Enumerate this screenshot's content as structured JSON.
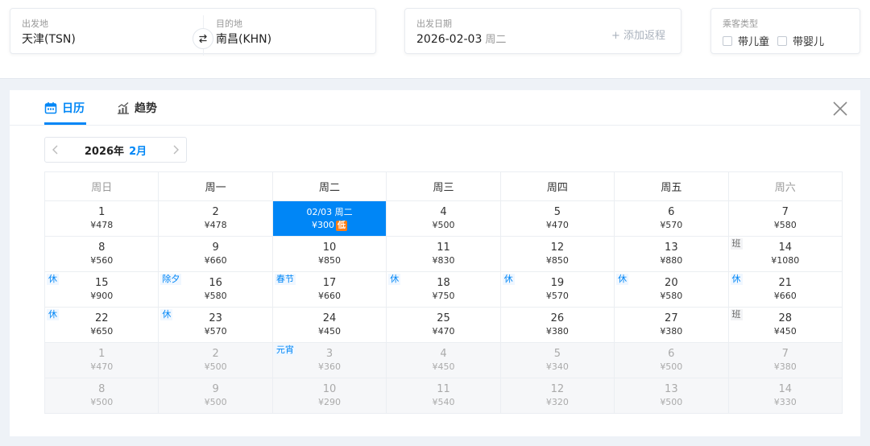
{
  "search": {
    "from_label": "出发地",
    "from_value": "天津(TSN)",
    "to_label": "目的地",
    "to_value": "南昌(KHN)",
    "date_label": "出发日期",
    "date_value": "2026-02-03",
    "date_weekday": "周二",
    "add_return": "+ 添加返程",
    "passenger_label": "乘客类型",
    "child_label": "带儿童",
    "infant_label": "带婴儿"
  },
  "tabs": {
    "calendar": "日历",
    "trend": "趋势"
  },
  "month_nav": {
    "year": "2026年",
    "month": "2月"
  },
  "weekdays": [
    "周日",
    "周一",
    "周二",
    "周三",
    "周四",
    "周五",
    "周六"
  ],
  "weeks": [
    [
      {
        "day": "1",
        "price": "¥478"
      },
      {
        "day": "2",
        "price": "¥478"
      },
      {
        "day": "02/03 周二",
        "price": "¥300",
        "selected": true,
        "badge": "低"
      },
      {
        "day": "4",
        "price": "¥500"
      },
      {
        "day": "5",
        "price": "¥470"
      },
      {
        "day": "6",
        "price": "¥570"
      },
      {
        "day": "7",
        "price": "¥580"
      }
    ],
    [
      {
        "day": "8",
        "price": "¥560"
      },
      {
        "day": "9",
        "price": "¥660"
      },
      {
        "day": "10",
        "price": "¥850"
      },
      {
        "day": "11",
        "price": "¥830"
      },
      {
        "day": "12",
        "price": "¥850"
      },
      {
        "day": "13",
        "price": "¥880"
      },
      {
        "day": "14",
        "price": "¥1080",
        "tag": "班"
      }
    ],
    [
      {
        "day": "15",
        "price": "¥900",
        "tag": "休"
      },
      {
        "day": "16",
        "price": "¥580",
        "tag": "除夕"
      },
      {
        "day": "17",
        "price": "¥660",
        "tag": "春节"
      },
      {
        "day": "18",
        "price": "¥750",
        "tag": "休"
      },
      {
        "day": "19",
        "price": "¥570",
        "tag": "休"
      },
      {
        "day": "20",
        "price": "¥580",
        "tag": "休"
      },
      {
        "day": "21",
        "price": "¥660",
        "tag": "休"
      }
    ],
    [
      {
        "day": "22",
        "price": "¥650",
        "tag": "休"
      },
      {
        "day": "23",
        "price": "¥570",
        "tag": "休"
      },
      {
        "day": "24",
        "price": "¥450"
      },
      {
        "day": "25",
        "price": "¥470"
      },
      {
        "day": "26",
        "price": "¥380"
      },
      {
        "day": "27",
        "price": "¥380"
      },
      {
        "day": "28",
        "price": "¥450",
        "tag": "班"
      }
    ],
    [
      {
        "day": "1",
        "price": "¥470",
        "next": true
      },
      {
        "day": "2",
        "price": "¥500",
        "next": true
      },
      {
        "day": "3",
        "price": "¥360",
        "next": true,
        "tag": "元宵"
      },
      {
        "day": "4",
        "price": "¥450",
        "next": true
      },
      {
        "day": "5",
        "price": "¥340",
        "next": true
      },
      {
        "day": "6",
        "price": "¥500",
        "next": true
      },
      {
        "day": "7",
        "price": "¥380",
        "next": true
      }
    ],
    [
      {
        "day": "8",
        "price": "¥500",
        "next": true
      },
      {
        "day": "9",
        "price": "¥500",
        "next": true
      },
      {
        "day": "10",
        "price": "¥290",
        "next": true
      },
      {
        "day": "11",
        "price": "¥540",
        "next": true
      },
      {
        "day": "12",
        "price": "¥320",
        "next": true
      },
      {
        "day": "13",
        "price": "¥500",
        "next": true
      },
      {
        "day": "14",
        "price": "¥330",
        "next": true
      }
    ]
  ],
  "colors": {
    "accent": "#0086f6",
    "low_badge": "#ff7d13",
    "holiday_tag": "#0086f6"
  },
  "icons": [
    "swap-icon",
    "calendar-icon",
    "trend-icon",
    "close-icon",
    "chevron-left-icon",
    "chevron-right-icon"
  ]
}
